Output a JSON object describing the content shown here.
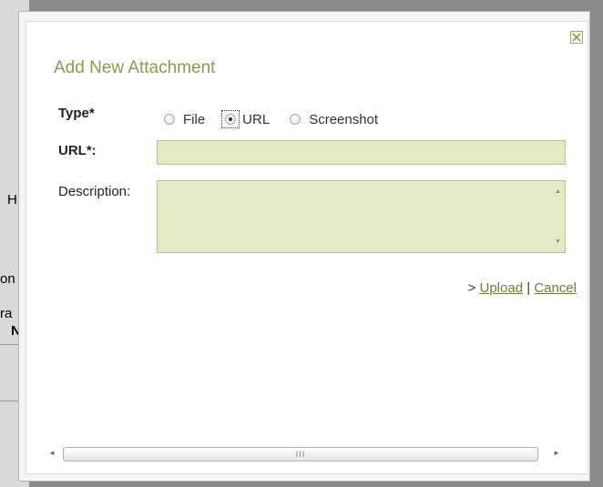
{
  "dialog": {
    "title": "Add New Attachment",
    "close_icon": "close-icon"
  },
  "form": {
    "type_label": "Type*",
    "type_options": [
      {
        "label": "File",
        "checked": false
      },
      {
        "label": "URL",
        "checked": true
      },
      {
        "label": "Screenshot",
        "checked": false
      }
    ],
    "url_label": "URL*:",
    "url_value": "",
    "description_label": "Description:",
    "description_value": ""
  },
  "actions": {
    "prefix": ">",
    "upload_label": "Upload",
    "separator": "|",
    "cancel_label": "Cancel"
  },
  "scrollbar": {
    "grip": "III"
  },
  "background": {
    "fragments": [
      "H",
      "on",
      "ra",
      "N"
    ]
  },
  "colors": {
    "title": "#8b9a4b",
    "field_bg": "#e3e9c6",
    "link": "#6f7d34"
  }
}
